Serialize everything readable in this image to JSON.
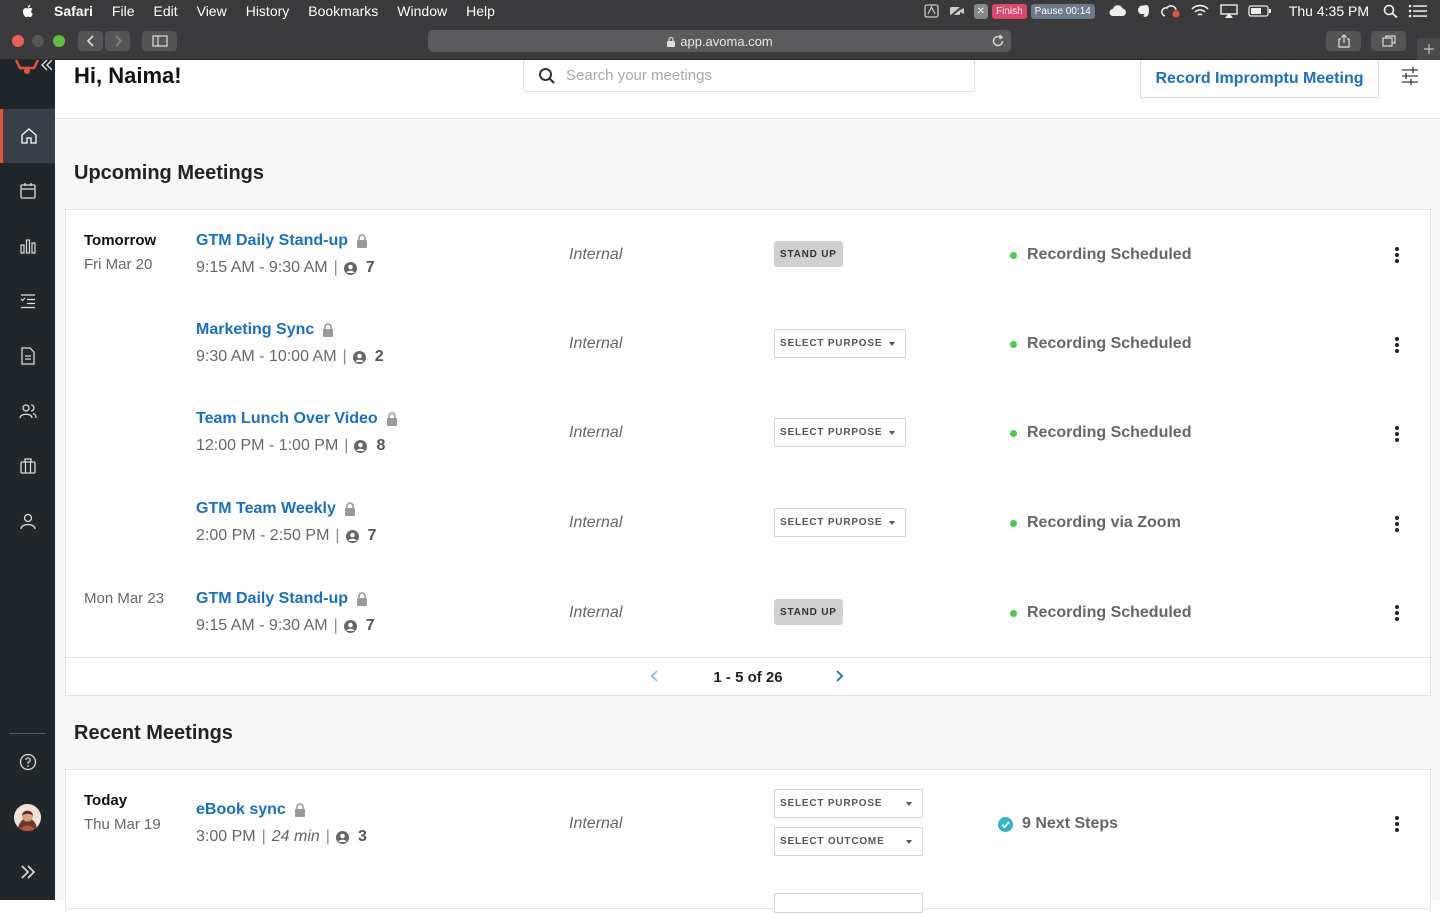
{
  "menubar": {
    "app": "Safari",
    "items": [
      "File",
      "Edit",
      "View",
      "History",
      "Bookmarks",
      "Window",
      "Help"
    ],
    "finish_label": "Finish",
    "pause_label": "Pause 00:14",
    "clock": "Thu 4:35 PM"
  },
  "browser": {
    "url": "app.avoma.com"
  },
  "header": {
    "greeting": "Hi, Naima!",
    "search_placeholder": "Search your meetings",
    "record_button": "Record Impromptu Meeting"
  },
  "upcoming": {
    "title": "Upcoming Meetings",
    "rows": [
      {
        "date_main": "Tomorrow",
        "date_sub": "Fri Mar 20",
        "title": "GTM Daily Stand-up",
        "time": "9:15 AM - 9:30 AM",
        "attendees": "7",
        "type": "Internal",
        "purpose": "STAND UP",
        "status": "Recording Scheduled"
      },
      {
        "date_main": "",
        "date_sub": "",
        "title": "Marketing Sync",
        "time": "9:30 AM - 10:00 AM",
        "attendees": "2",
        "type": "Internal",
        "purpose": "SELECT PURPOSE",
        "status": "Recording Scheduled"
      },
      {
        "date_main": "",
        "date_sub": "",
        "title": "Team Lunch Over Video",
        "time": "12:00 PM - 1:00 PM",
        "attendees": "8",
        "type": "Internal",
        "purpose": "SELECT PURPOSE",
        "status": "Recording Scheduled"
      },
      {
        "date_main": "",
        "date_sub": "",
        "title": "GTM Team Weekly",
        "time": "2:00 PM - 2:50 PM",
        "attendees": "7",
        "type": "Internal",
        "purpose": "SELECT PURPOSE",
        "status": "Recording via Zoom"
      },
      {
        "date_main": "",
        "date_sub": "Mon Mar 23",
        "title": "GTM Daily Stand-up",
        "time": "9:15 AM - 9:30 AM",
        "attendees": "7",
        "type": "Internal",
        "purpose": "STAND UP",
        "status": "Recording Scheduled"
      }
    ],
    "pagination": "1 - 5 of 26"
  },
  "recent": {
    "title": "Recent Meetings",
    "rows": [
      {
        "date_main": "Today",
        "date_sub": "Thu Mar 19",
        "title": "eBook sync",
        "time": "3:00 PM",
        "duration": "24 min",
        "attendees": "3",
        "type": "Internal",
        "purpose": "SELECT PURPOSE",
        "outcome": "SELECT OUTCOME",
        "status": "9 Next Steps"
      }
    ]
  },
  "colors": {
    "sidebar": "#21262b",
    "accent": "#1a6fc4",
    "active_nav": "#e8553f",
    "status_dot": "#4cc84a",
    "check": "#2fb5c9"
  },
  "icons": {
    "nav": [
      "home-icon",
      "calendar-icon",
      "bar-chart-icon",
      "list-icon",
      "document-icon",
      "people-icon",
      "briefcase-icon",
      "user-icon"
    ],
    "bottom": [
      "help-icon",
      "avatar",
      "expand-icon"
    ]
  }
}
